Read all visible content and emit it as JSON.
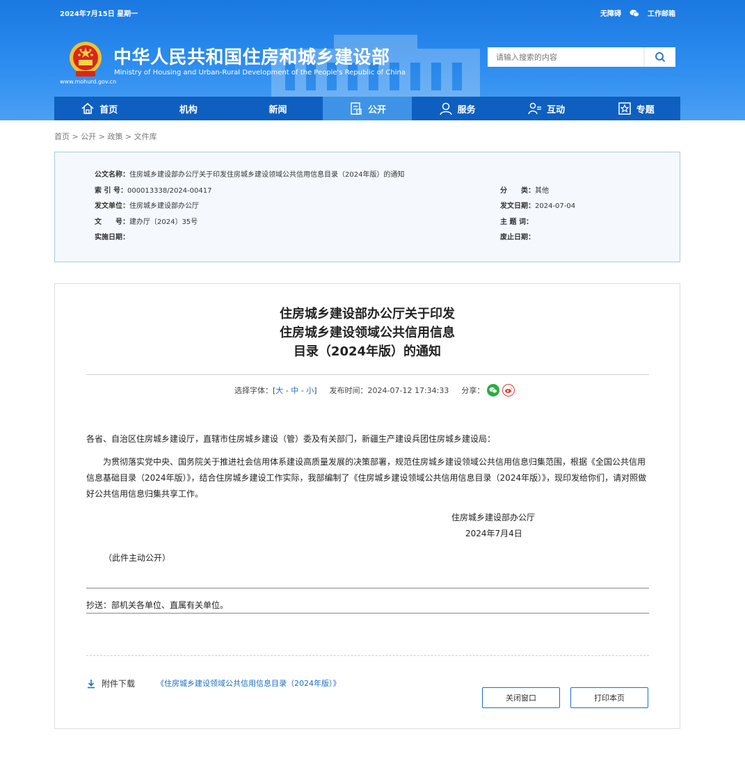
{
  "header": {
    "date": "2024年7月15日 星期一",
    "accessibility": "无障碍",
    "mail": "工作邮箱",
    "site_title": "中华人民共和国住房和城乡建设部",
    "site_subtitle": "Ministry of Housing and Urban-Rural Development of the People's Republic of China",
    "site_url": "www.mohurd.gov.cn",
    "search_placeholder": "请输入搜索的内容"
  },
  "nav": [
    {
      "label": "首页",
      "icon": "home-icon"
    },
    {
      "label": "机构",
      "icon": ""
    },
    {
      "label": "新闻",
      "icon": ""
    },
    {
      "label": "公开",
      "icon": "document-icon",
      "active": true
    },
    {
      "label": "服务",
      "icon": "user-service-icon"
    },
    {
      "label": "互动",
      "icon": "interact-icon"
    },
    {
      "label": "专题",
      "icon": "star-icon"
    }
  ],
  "breadcrumb": "首页 > 公开 > 政策 > 文件库",
  "meta": {
    "name_label": "公文名称：",
    "name_value": "住房城乡建设部办公厅关于印发住房城乡建设领域公共信用信息目录（2024年版）的通知",
    "index_label": "索 引 号：",
    "index_value": "000013338/2024-00417",
    "category_label": "分　　类：",
    "category_value": "其他",
    "issuer_label": "发文单位：",
    "issuer_value": "住房城乡建设部办公厅",
    "issue_date_label": "发文日期：",
    "issue_date_value": "2024-07-04",
    "doc_no_label": "文　　号：",
    "doc_no_value": "建办厅〔2024〕35号",
    "keywords_label": "主 题 词：",
    "keywords_value": "",
    "effective_label": "实施日期：",
    "effective_value": "",
    "expire_label": "废止日期：",
    "expire_value": ""
  },
  "article": {
    "title_line1": "住房城乡建设部办公厅关于印发",
    "title_line2": "住房城乡建设领域公共信用信息",
    "title_line3": "目录（2024年版）的通知",
    "font_label": "选择字体：[",
    "font_large": "大",
    "font_mid": "中",
    "font_small": "小",
    "font_end": "]",
    "publish": "发布时间：2024-07-12 17:34:33",
    "share": "分享：",
    "p1": "各省、自治区住房城乡建设厅，直辖市住房城乡建设（管）委及有关部门，新疆生产建设兵团住房城乡建设局：",
    "p2": "为贯彻落实党中央、国务院关于推进社会信用体系建设高质量发展的决策部署，规范住房城乡建设领域公共信用信息归集范围，根据《全国公共信用信息基础目录（2024年版）》，结合住房城乡建设工作实际，我部编制了《住房城乡建设领域公共信用信息目录（2024年版）》，现印发给你们，请对照做好公共信用信息归集共享工作。",
    "sign_org": "住房城乡建设部办公厅",
    "sign_date": "2024年7月4日",
    "note": "（此件主动公开）",
    "cc": "抄送：部机关各单位、直属有关单位。",
    "attach_label": "附件下载",
    "attach_link": "《住房城乡建设领域公共信用信息目录（2024年版）》",
    "close_btn": "关闭窗口",
    "print_btn": "打印本页"
  },
  "colors": {
    "brand": "#1a78e0",
    "nav": "#0e5fc0",
    "link": "#1a6ec8"
  }
}
